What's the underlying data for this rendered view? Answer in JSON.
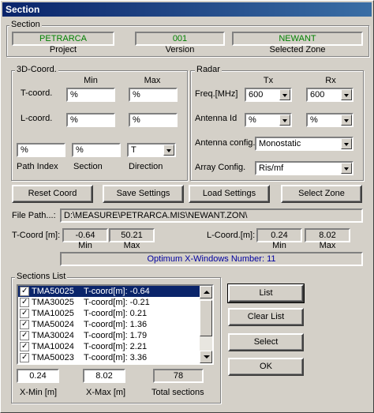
{
  "window": {
    "title": "Section"
  },
  "section": {
    "legend": "Section",
    "project": {
      "value": "PETRARCA",
      "label": "Project"
    },
    "version": {
      "value": "001",
      "label": "Version"
    },
    "zone": {
      "value": "NEWANT",
      "label": "Selected Zone"
    }
  },
  "coord3d": {
    "legend": "3D-Coord.",
    "min_header": "Min",
    "max_header": "Max",
    "t_label": "T-coord.",
    "t_min": "%",
    "t_max": "%",
    "l_label": "L-coord.",
    "l_min": "%",
    "l_max": "%",
    "path_index": {
      "value": "%",
      "label": "Path Index"
    },
    "section_f": {
      "value": "%",
      "label": "Section"
    },
    "direction": {
      "value": "T",
      "label": "Direction"
    }
  },
  "radar": {
    "legend": "Radar",
    "tx_header": "Tx",
    "rx_header": "Rx",
    "freq_label": "Freq.[MHz]",
    "freq_tx": "600",
    "freq_rx": "600",
    "antenna_id_label": "Antenna Id",
    "antenna_tx": "%",
    "antenna_rx": "%",
    "antenna_config_label": "Antenna config.",
    "antenna_config": "Monostatic",
    "array_config_label": "Array Config.",
    "array_config": "Ris/mf"
  },
  "buttons": {
    "reset": "Reset Coord",
    "save": "Save Settings",
    "load": "Load Settings",
    "select_zone": "Select Zone",
    "list": "List",
    "clear_list": "Clear List",
    "select": "Select",
    "ok": "OK"
  },
  "filepath": {
    "label": "File Path...:",
    "value": "D:\\MEASURE\\PETRARCA.MIS\\NEWANT.ZON\\"
  },
  "tcoord": {
    "label": "T-Coord [m]:",
    "min": "-0.64",
    "max": "50.21",
    "min_label": "Min",
    "max_label": "Max"
  },
  "lcoord": {
    "label": "L-Coord.[m]:",
    "min": "0.24",
    "max": "8.02",
    "min_label": "Min",
    "max_label": "Max"
  },
  "optimum": "Optimum X-Windows Number: 11",
  "sections_list": {
    "legend": "Sections List",
    "rows": [
      {
        "name": "TMA50025",
        "coord": "T-coord[m]: -0.64"
      },
      {
        "name": "TMA30025",
        "coord": "T-coord[m]: -0.21"
      },
      {
        "name": "TMA10025",
        "coord": "T-coord[m]: 0.21"
      },
      {
        "name": "TMA50024",
        "coord": "T-coord[m]: 1.36"
      },
      {
        "name": "TMA30024",
        "coord": "T-coord[m]: 1.79"
      },
      {
        "name": "TMA10024",
        "coord": "T-coord[m]: 2.21"
      },
      {
        "name": "TMA50023",
        "coord": "T-coord[m]: 3.36"
      }
    ]
  },
  "bottom": {
    "xmin": {
      "value": "0.24",
      "label": "X-Min [m]"
    },
    "xmax": {
      "value": "8.02",
      "label": "X-Max [m]"
    },
    "total": {
      "value": "78",
      "label": "Total sections"
    }
  },
  "colors": {
    "title_bar": "#0a246a",
    "value_green": "#008000",
    "value_blue": "#0000a0",
    "selection": "#0a246a"
  }
}
